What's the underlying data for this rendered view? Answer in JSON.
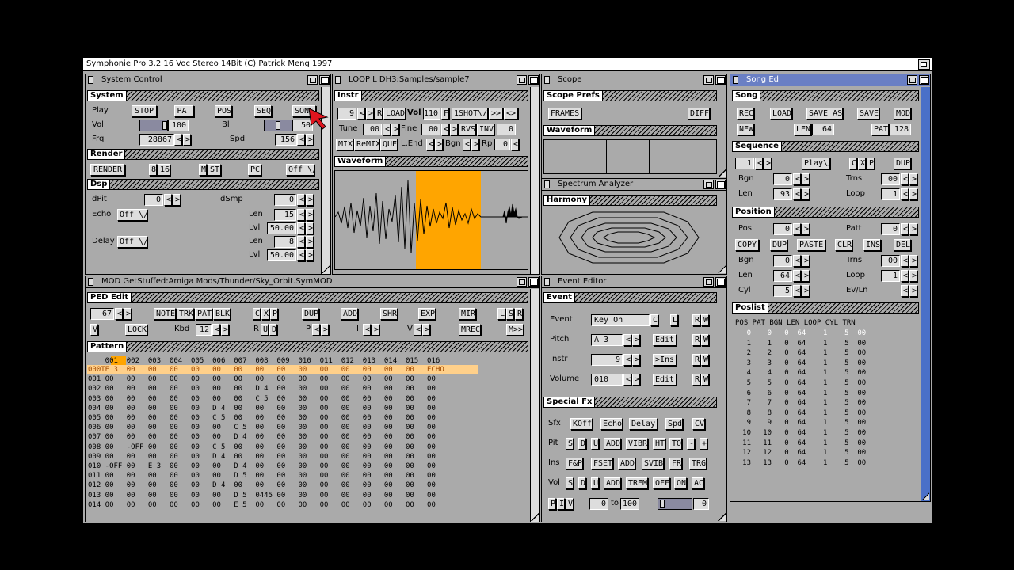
{
  "screen_title": "Symphonie Pro 3.2  16 Voc Stereo 14Bit (C) Patrick Meng 1997",
  "icons": {
    "depth": "depth-gadget-icon",
    "close": "close-gadget-icon",
    "zoom": "zoom-gadget-icon",
    "pointer": "mouse-pointer-icon"
  },
  "colors": {
    "active_title": "#6a7fc4",
    "accent_orange": "#ffa500",
    "panel": "#aaaaaa",
    "gadget": "#dddddd",
    "scrollbar": "#4a70c8"
  },
  "system_control": {
    "title": "System Control",
    "section": "System",
    "play_label": "Play",
    "stop": "STOP",
    "pat": "PAT",
    "pos": "POS",
    "seq": "SEQ",
    "song": "SONG",
    "vol_label": "Vol",
    "vol": "100",
    "bl_label": "Bl",
    "bl": "50",
    "frq_label": "Frq",
    "frq": "28867",
    "spd_label": "Spd",
    "spd": "156",
    "render_section": "Render",
    "render_btn": "RENDER",
    "render_bits_a": "8",
    "render_bits_b": "16",
    "m": "M",
    "st": "ST",
    "pc": "PC",
    "render_off": "Off",
    "dsp_section": "Dsp",
    "dpit_label": "dPit",
    "dpit": "0",
    "dsmp_label": "dSmp",
    "dsmp": "0",
    "echo_label": "Echo",
    "echo": "Off",
    "len_label": "Len",
    "len1": "15",
    "lvl_label": "Lvl",
    "lvl1": "50.00",
    "delay_label": "Delay",
    "delay": "Off",
    "len2": "8",
    "lvl2": "50.00"
  },
  "instrument": {
    "title": "LOOP L DH3:Samples/sample7",
    "section": "Instr",
    "num": "9",
    "r": "R",
    "load": "LOAD",
    "vol_label": "Vol",
    "vol": "110",
    "f": "F",
    "oneshot": "1SHOT",
    "tune_label": "Tune",
    "tune": "00",
    "fine_label": "Fine",
    "fine": "00",
    "rvs": "RVS",
    "inv": "INV",
    "zero": "0",
    "mix": "MIX",
    "remix": "ReMIX",
    "que": "QUE",
    "lend_label": "L.End",
    "bgn_label": "Bgn",
    "rp_label": "Rp",
    "rp": "0",
    "wave_section": "Waveform",
    "fwd": ">>",
    "loopmark": "<>"
  },
  "scope": {
    "title": "Scope",
    "section": "Scope Prefs",
    "frames": "FRAMES",
    "diff": "DIFF",
    "wave_section": "Waveform"
  },
  "spectrum": {
    "title": "Spectrum Analyzer",
    "section": "Harmony"
  },
  "song_ed": {
    "title": "Song Ed",
    "section": "Song",
    "rec": "REC",
    "load": "LOAD",
    "save_as": "SAVE AS",
    "save": "SAVE",
    "mod": "MOD",
    "new": "NEW",
    "len_label": "LEN",
    "len": "64",
    "pat_label": "PAT",
    "pat": "128",
    "seq_section": "Sequence",
    "seq_num": "1",
    "play": "Play",
    "c": "C",
    "x": "X",
    "p": "P",
    "dup": "DUP",
    "bgn_label": "Bgn",
    "bgn": "0",
    "trns_label": "Trns",
    "trns": "00",
    "len2_label": "Len",
    "len2": "93",
    "loop_label": "Loop",
    "loop": "1",
    "pos_section": "Position",
    "pos_label": "Pos",
    "pos": "0",
    "patt_label": "Patt",
    "patt": "0",
    "copy": "COPY",
    "pdup": "DUP",
    "paste": "PASTE",
    "clr": "CLR",
    "ins": "INS",
    "del": "DEL",
    "pbgn": "0",
    "ptrns": "00",
    "plen": "64",
    "ploop": "1",
    "cyl_label": "Cyl",
    "cyl": "5",
    "evln_label": "Ev/Ln",
    "poslist_section": "Poslist",
    "poslist_header": "POS PAT BGN LEN LOOP CYL TRN",
    "poslist": [
      "0",
      "1",
      "2",
      "3",
      "4",
      "5",
      "6",
      "7",
      "8",
      "9",
      "10",
      "11",
      "12",
      "13"
    ]
  },
  "pattern": {
    "title": "MOD  GetStuffed:Amiga Mods/Thunder/Sky_Orbit.SymMOD",
    "ped_section": "PED Edit",
    "num": "67",
    "note": "NOTE",
    "trk": "TRK",
    "pat": "PAT",
    "blk": "BLK",
    "c": "C",
    "x": "X",
    "p": "P",
    "dup": "DUP",
    "add": "ADD",
    "shr": "SHR",
    "exp": "EXP",
    "mir": "MIR",
    "l": "L",
    "s": "S",
    "r": "R",
    "v": "V",
    "lock": "LOCK",
    "kbd_label": "Kbd",
    "kbd": "12",
    "u": "U",
    "d": "D",
    "p2": "P",
    "i": "I",
    "v2": "V",
    "mrec": "MREC",
    "next": "M>>",
    "pattern_section": "Pattern",
    "header": "    001  002  003  004  005  006  007  008  009  010  011  012  013  014  015  016",
    "rows": [
      "000TE 3  00   00   00   00   00   00   00   00   00   00   00   00   00   00   ECHO",
      "001 00   00   00   00   00   00   00   00   00   00   00   00   00   00   00   00",
      "002 00   00   00   00   00   00   00   D 4  00   00   00   00   00   00   00   00",
      "003 00   00   00   00   00   00   00   C 5  00   00   00   00   00   00   00   00",
      "004 00   00   00   00   00   D 4  00   00   00   00   00   00   00   00   00   00",
      "005 00   00   00   00   00   C 5  00   00   00   00   00   00   00   00   00   00",
      "006 00   00   00   00   00   00   C 5  00   00   00   00   00   00   00   00   00",
      "007 00   00   00   00   00   00   D 4  00   00   00   00   00   00   00   00   00",
      "008 00   -OFF 00   00   00   C 5  00   00   00   00   00   00   00   00   00   00",
      "009 00   00   00   00   00   D 4  00   00   00   00   00   00   00   00   00   00",
      "010 -OFF 00   E 3  00   00   00   D 4  00   00   00   00   00   00   00   00   00",
      "011 00   00   00   00   00   00   D 5  00   00   00   00   00   00   00   00   00",
      "012 00   00   00   00   00   D 4  00   00   00   00   00   00   00   00   00   00",
      "013 00   00   00   00   00   00   D 5  0445 00   00   00   00   00   00   00   00",
      "014 00   00   00   00   00   00   E 5  00   00   00   00   00   00   00   00   00"
    ]
  },
  "event": {
    "title": "Event Editor",
    "section": "Event",
    "event_label": "Event",
    "event": "Key On",
    "c": "C",
    "l": "L",
    "r": "R",
    "w": "W",
    "pitch_label": "Pitch",
    "pitch": "A 3",
    "edit": "Edit",
    "instr_label": "Instr",
    "instr": "9",
    "ins": ">Ins",
    "volume_label": "Volume",
    "volume": "010",
    "sfx_section": "Special Fx",
    "sfx_label": "Sfx",
    "koff": "KOff",
    "echo": "Echo",
    "delay": "Delay",
    "spd": "Spd",
    "cv": "CV",
    "pit_label": "Pit",
    "s": "S",
    "d": "D",
    "u": "U",
    "add": "ADD",
    "vibr": "VIBR",
    "ht": "HT",
    "to": "TO",
    "minus": "-",
    "plus": "+",
    "ins_label": "Ins",
    "fp": "F&P",
    "fset": "FSET",
    "svib": "SVIB",
    "fr": "FR",
    "trg": "TRG",
    "vol_label": "Vol",
    "trem": "TREM",
    "off": "OFF",
    "on": "ON",
    "ac": "AC",
    "piv_p": "P",
    "piv_i": "I",
    "piv_v": "V",
    "from": "0",
    "to_label": "to",
    "to_val": "100",
    "last": "0"
  }
}
